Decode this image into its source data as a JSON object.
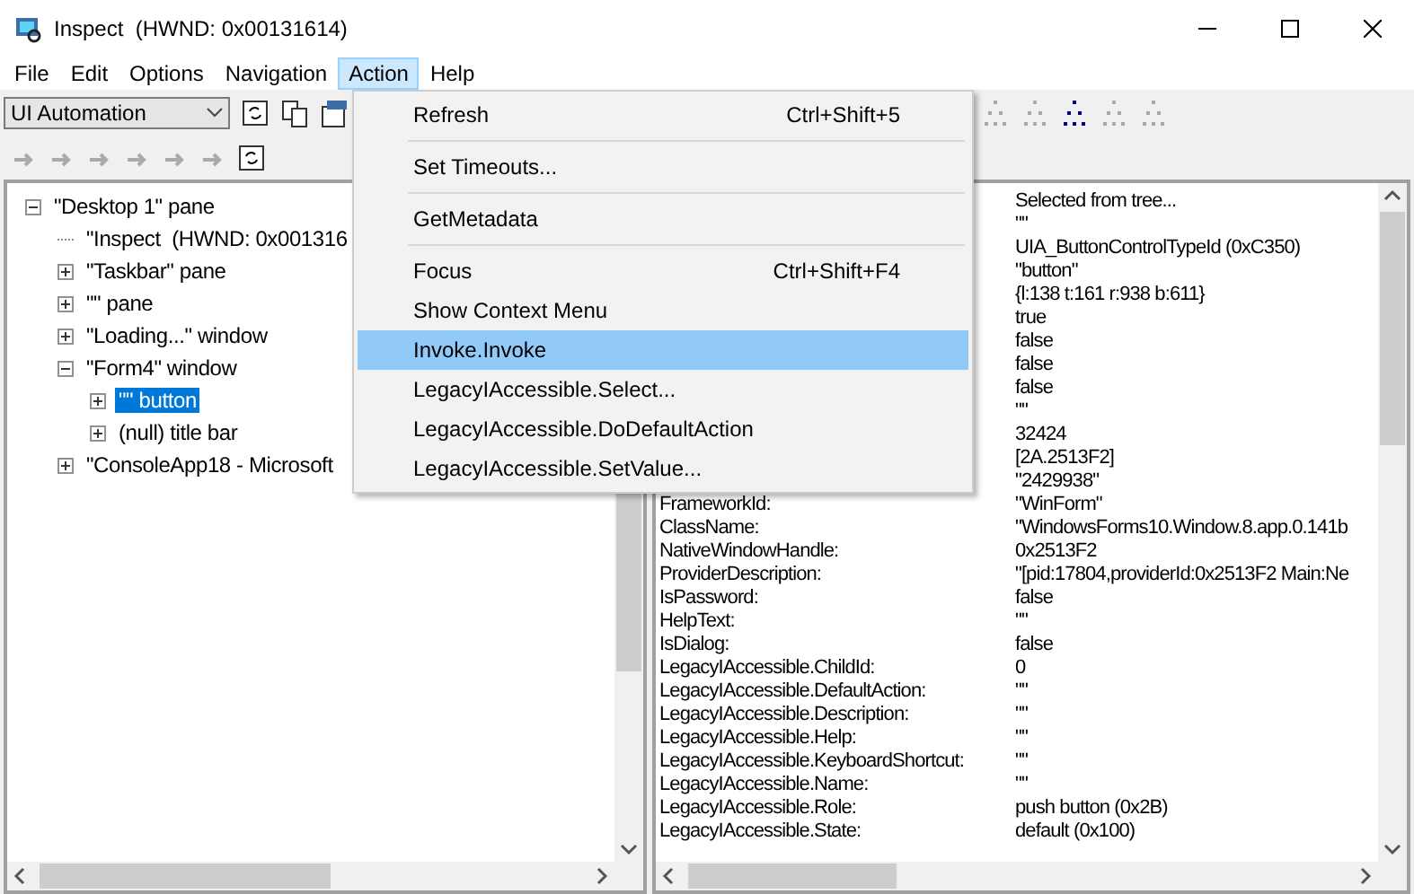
{
  "window": {
    "title": "Inspect  (HWND: 0x00131614)"
  },
  "menu_bar": [
    {
      "label": "File",
      "selected": false
    },
    {
      "label": "Edit",
      "selected": false
    },
    {
      "label": "Options",
      "selected": false
    },
    {
      "label": "Navigation",
      "selected": false
    },
    {
      "label": "Action",
      "selected": true
    },
    {
      "label": "Help",
      "selected": false
    }
  ],
  "toolbar": {
    "mode_select": "UI Automation"
  },
  "action_menu": [
    {
      "kind": "item",
      "label": "Refresh",
      "shortcut": "Ctrl+Shift+5",
      "selected": false
    },
    {
      "kind": "separator"
    },
    {
      "kind": "item",
      "label": "Set Timeouts...",
      "selected": false
    },
    {
      "kind": "separator"
    },
    {
      "kind": "item",
      "label": "GetMetadata",
      "selected": false
    },
    {
      "kind": "separator"
    },
    {
      "kind": "item",
      "label": "Focus",
      "shortcut": "Ctrl+Shift+F4",
      "selected": false
    },
    {
      "kind": "item",
      "label": "Show Context Menu",
      "selected": false
    },
    {
      "kind": "item",
      "label": "Invoke.Invoke",
      "selected": true
    },
    {
      "kind": "item",
      "label": "LegacyIAccessible.Select...",
      "selected": false
    },
    {
      "kind": "item",
      "label": "LegacyIAccessible.DoDefaultAction",
      "selected": false
    },
    {
      "kind": "item",
      "label": "LegacyIAccessible.SetValue...",
      "selected": false
    }
  ],
  "tree": [
    {
      "label": "\"Desktop 1\" pane",
      "expanded": true,
      "selected": false,
      "children": [
        {
          "label": "\"Inspect  (HWND: 0x001316",
          "selected": false
        },
        {
          "label": "\"Taskbar\" pane",
          "expanded": false,
          "selected": false
        },
        {
          "label": "\"\" pane",
          "expanded": false,
          "selected": false
        },
        {
          "label": "\"Loading...\" window",
          "expanded": false,
          "selected": false
        },
        {
          "label": "\"Form4\" window",
          "expanded": true,
          "selected": false,
          "children": [
            {
              "label": "\"\" button",
              "expanded": false,
              "selected": true
            },
            {
              "label": "(null) title bar",
              "expanded": false,
              "selected": false
            }
          ]
        },
        {
          "label": "\"ConsoleApp18 - Microsoft",
          "expanded": false,
          "selected": false
        }
      ]
    }
  ],
  "properties": [
    {
      "value": "Selected from tree..."
    },
    {
      "value": "\"\""
    },
    {
      "value": "UIA_ButtonControlTypeId (0xC350)"
    },
    {
      "value": "\"button\""
    },
    {
      "value": "{l:138 t:161 r:938 b:611}"
    },
    {
      "value": "true"
    },
    {
      "value": "false"
    },
    {
      "value": "false"
    },
    {
      "value": "false"
    },
    {
      "value": "\"\""
    },
    {
      "value": "32424"
    },
    {
      "value": "[2A.2513F2]"
    },
    {
      "value": "\"2429938\""
    },
    {
      "label": "FrameworkId:",
      "value": "\"WinForm\""
    },
    {
      "label": "ClassName:",
      "value": "\"WindowsForms10.Window.8.app.0.141b"
    },
    {
      "label": "NativeWindowHandle:",
      "value": "0x2513F2"
    },
    {
      "label": "ProviderDescription:",
      "value": "\"[pid:17804,providerId:0x2513F2 Main:Ne"
    },
    {
      "label": "IsPassword:",
      "value": "false"
    },
    {
      "label": "HelpText:",
      "value": "\"\""
    },
    {
      "label": "IsDialog:",
      "value": "false"
    },
    {
      "label": "LegacyIAccessible.ChildId:",
      "value": "0"
    },
    {
      "label": "LegacyIAccessible.DefaultAction:",
      "value": "\"\""
    },
    {
      "label": "LegacyIAccessible.Description:",
      "value": "\"\""
    },
    {
      "label": "LegacyIAccessible.Help:",
      "value": "\"\""
    },
    {
      "label": "LegacyIAccessible.KeyboardShortcut:",
      "value": "\"\""
    },
    {
      "label": "LegacyIAccessible.Name:",
      "value": "\"\""
    },
    {
      "label": "LegacyIAccessible.Role:",
      "value": "push button (0x2B)"
    },
    {
      "label": "LegacyIAccessible.State:",
      "value": "default (0x100)"
    }
  ]
}
